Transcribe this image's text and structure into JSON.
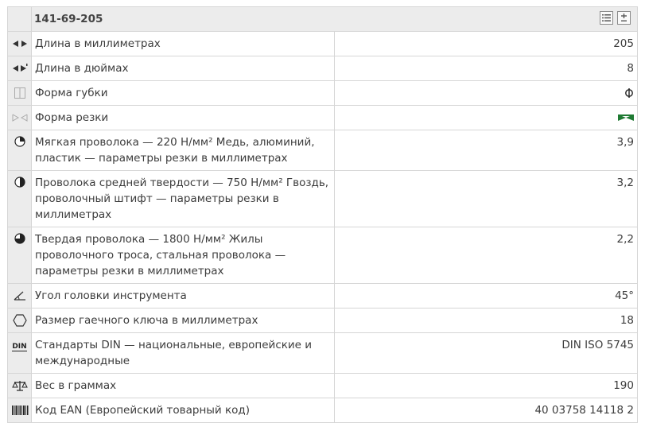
{
  "header": {
    "article": "141-69-205"
  },
  "rows": [
    {
      "icon": "length-arrows-icon",
      "label": "Длина в миллиметрах",
      "value": "205"
    },
    {
      "icon": "length-inch-arrows-icon",
      "label": "Длина в дюймах",
      "value": "8"
    },
    {
      "icon": "jaw-shape-icon",
      "label": "Форма губки",
      "value": "ⴲ",
      "value_icon": "round-jaw-symbol-icon"
    },
    {
      "icon": "cutting-shape-icon",
      "label": "Форма резки",
      "value": "",
      "value_icon": "green-bow-tie-icon",
      "value_color": "#1f7a33"
    },
    {
      "icon": "quarter-circle-icon",
      "label": "Мягкая проволока — 220 Н/мм² Медь, алюминий, пластик — параметры резки в миллиметрах",
      "value": "3,9"
    },
    {
      "icon": "half-circle-icon",
      "label": "Проволока средней твердости — 750 Н/мм² Гвоздь, проволочный штифт — параметры резки в миллиметрах",
      "value": "3,2"
    },
    {
      "icon": "three-quarter-circle-icon",
      "label": "Твердая проволока — 1800 Н/мм² Жилы проволочного троса, стальная проволока — параметры резки в миллиметрах",
      "value": "2,2"
    },
    {
      "icon": "head-angle-icon",
      "label": "Угол головки инструмента",
      "value": "45°"
    },
    {
      "icon": "hexagon-icon",
      "label": "Размер гаечного ключа в миллиметрах",
      "value": "18"
    },
    {
      "icon": "din-icon",
      "label": "Стандарты DIN — национальные, европейские и международные",
      "value": "DIN ISO 5745",
      "icon_text": "DIN"
    },
    {
      "icon": "scales-icon",
      "label": "Вес в граммах",
      "value": "190"
    },
    {
      "icon": "barcode-icon",
      "label": "Код EAN (Европейский товарный код)",
      "value": "40 03758 14118 2"
    }
  ]
}
